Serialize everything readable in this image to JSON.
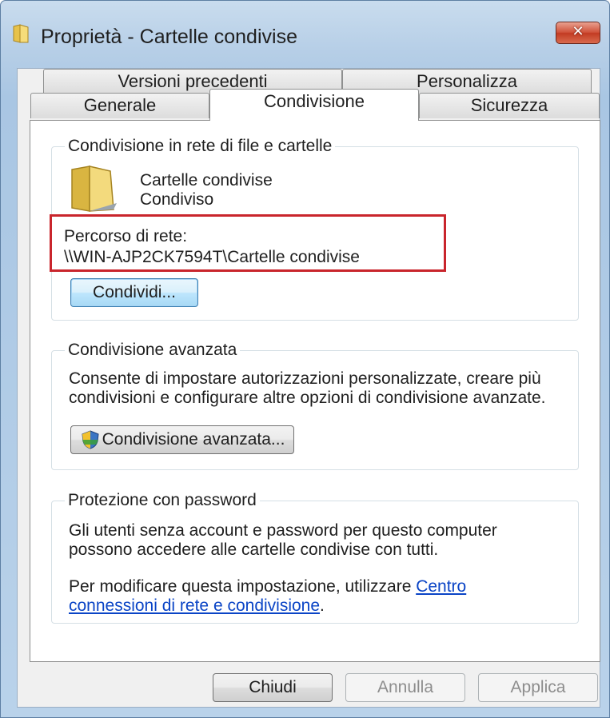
{
  "window": {
    "title": "Proprietà - Cartelle condivise",
    "close_symbol": "✕"
  },
  "tabs": {
    "row1": [
      "Versioni precedenti",
      "Personalizza"
    ],
    "row2": [
      "Generale",
      "Condivisione",
      "Sicurezza"
    ],
    "active": "Condivisione"
  },
  "network_sharing": {
    "title": "Condivisione in rete di file e cartelle",
    "folder_name": "Cartelle condivise",
    "status": "Condiviso",
    "path_label": "Percorso di rete:",
    "path_value": "\\\\WIN-AJP2CK7594T\\Cartelle condivise",
    "share_button": "Condividi..."
  },
  "advanced_sharing": {
    "title": "Condivisione avanzata",
    "description_line1": "Consente di impostare autorizzazioni personalizzate, creare più",
    "description_line2": "condivisioni e configurare altre opzioni di condivisione avanzate.",
    "button": "Condivisione avanzata..."
  },
  "password_protection": {
    "title": "Protezione con password",
    "line1": "Gli utenti senza account e password per questo computer",
    "line2": "possono accedere alle cartelle condivise con tutti.",
    "line3_prefix": "Per modificare questa impostazione, utilizzare ",
    "link_part1": "Centro",
    "link_part2": "connessioni di rete e condivisione",
    "line4_suffix": "."
  },
  "footer": {
    "close": "Chiudi",
    "cancel": "Annulla",
    "apply": "Applica"
  },
  "colors": {
    "highlight_border": "#c9252c",
    "link": "#0a44c6",
    "close_button": "#c23b22"
  },
  "icons": [
    "folder-icon",
    "close-icon",
    "shield-icon"
  ]
}
